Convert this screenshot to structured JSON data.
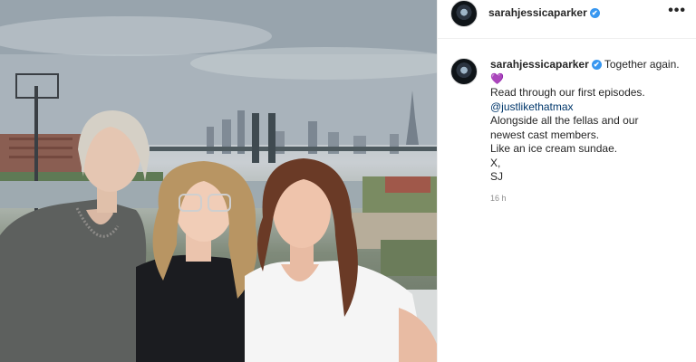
{
  "post": {
    "username": "sarahjessicaparker",
    "verified_mark": "✔",
    "more_label": "•••",
    "caption": {
      "first": "Together again.",
      "emoji": "💜",
      "line1": "Read through our first episodes.",
      "mention": "@justlikethatmax",
      "line2": "Alongside all the fellas and our",
      "line3": "newest cast members.",
      "line4": "Like an ice cream sundae.",
      "line5": "X,",
      "line6": "SJ"
    },
    "timestamp": "16 h"
  },
  "icons": {
    "more": "more-options-icon",
    "verified": "verified-badge-icon",
    "avatar": "profile-avatar"
  },
  "colors": {
    "verified": "#3897f0",
    "mention": "#00376b",
    "heart": "#8a5cd6",
    "muted": "#8e8e8e"
  }
}
